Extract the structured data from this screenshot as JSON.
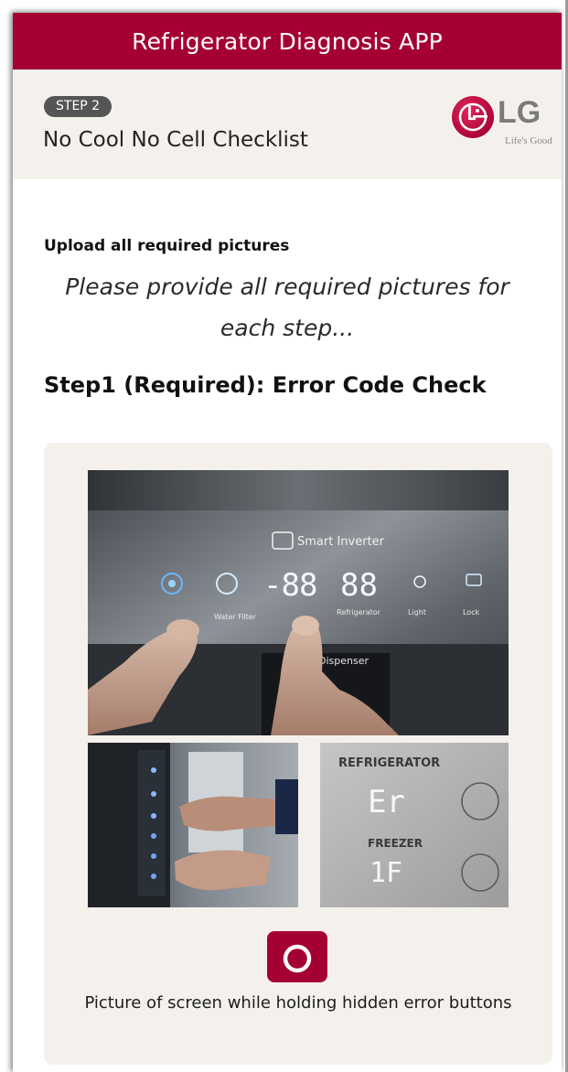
{
  "app": {
    "title": "Refrigerator Diagnosis APP"
  },
  "step": {
    "badge": "STEP 2",
    "title": "No Cool No Cell Checklist"
  },
  "brand": {
    "name": "LG",
    "tagline": "Life's Good",
    "color": "#a50034"
  },
  "upload": {
    "heading": "Upload all required pictures",
    "instructions": "Please provide all required pictures for each step..."
  },
  "section": {
    "title": "Step1 (Required): Error Code Check",
    "photo_main_text": {
      "brand_badge": "Smart Inverter",
      "labels": [
        "Water Filter",
        "Refrigerator",
        "Light",
        "Lock"
      ],
      "dispenser": "Dispenser"
    },
    "photo_disp_text": {
      "refrigerator": "REFRIGERATOR",
      "code_top": "Er",
      "freezer": "FREEZER",
      "code_bottom": "1F"
    },
    "camera_icon": "camera-icon",
    "caption": "Picture of screen while holding hidden error buttons"
  }
}
